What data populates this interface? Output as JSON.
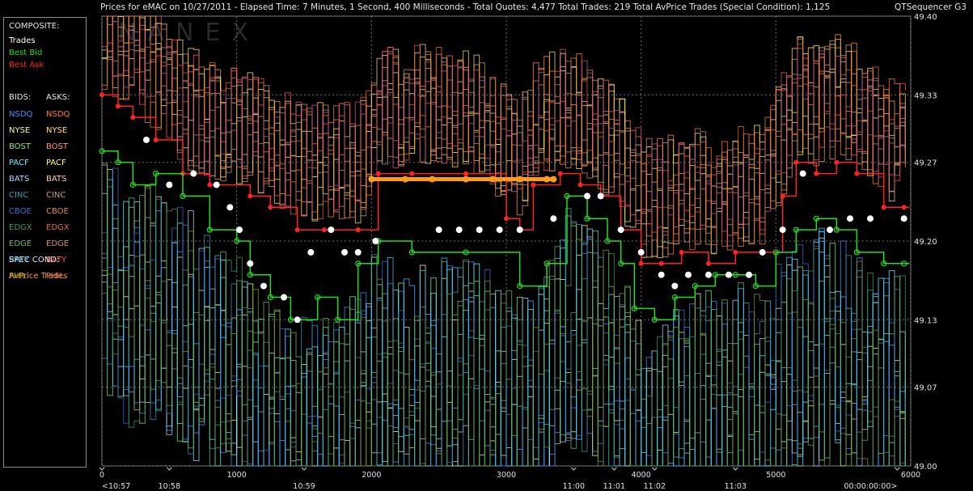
{
  "header": {
    "title": "Prices for  eMAC  on  10/27/2011  -  Elapsed Time: 7 Minutes, 1 Second, 400 Milliseconds  -  Total Quotes: 4,477  Total Trades: 219  Total AvPrice Trades (Special Condition): 1,125",
    "app_name": "QTSequencer G3"
  },
  "watermark": "NANEX",
  "legend": {
    "composite_heading": "COMPOSITE:",
    "composite_items": [
      {
        "label": "Trades",
        "color": "#ffffff"
      },
      {
        "label": "Best Bid",
        "color": "#22dd22"
      },
      {
        "label": "Best Ask",
        "color": "#ff2222"
      }
    ],
    "bids_heading": "BIDS:",
    "asks_heading": "ASKS:",
    "exchanges": [
      {
        "bid": "NSDQ",
        "bid_color": "#4a8cff",
        "ask": "NSDQ",
        "ask_color": "#ff7a2a"
      },
      {
        "bid": "NYSE",
        "bid_color": "#e8ff9a",
        "ask": "NYSE",
        "ask_color": "#ffe15a"
      },
      {
        "bid": "BOST",
        "bid_color": "#8ee88e",
        "ask": "BOST",
        "ask_color": "#ff9a6a"
      },
      {
        "bid": "PACF",
        "bid_color": "#6af0ff",
        "ask": "PACF",
        "ask_color": "#ffff60"
      },
      {
        "bid": "BATS",
        "bid_color": "#a8d8ff",
        "ask": "BATS",
        "ask_color": "#ffd0a0"
      },
      {
        "bid": "CINC",
        "bid_color": "#3a9ab0",
        "ask": "CINC",
        "ask_color": "#c9a060"
      },
      {
        "bid": "CBOE",
        "bid_color": "#3a6ad0",
        "ask": "CBOE",
        "ask_color": "#e09040"
      },
      {
        "bid": "EDGX",
        "bid_color": "#3f9a5a",
        "ask": "EDGX",
        "ask_color": "#e06a3a"
      },
      {
        "bid": "EDGE",
        "bid_color": "#6ab86a",
        "ask": "EDGE",
        "ask_color": "#d08a70"
      },
      {
        "bid": "BATY",
        "bid_color": "#4ac0ff",
        "ask": "BATY",
        "ask_color": "#ff5a5a"
      },
      {
        "bid": "PHIL",
        "bid_color": "#7a9a3a",
        "ask": "PHIL",
        "ask_color": "#c05a8a"
      }
    ],
    "spec_heading": "SPEC COND:",
    "spec_item": {
      "label": "AvPrice Trades",
      "color": "#ff9a1a"
    }
  },
  "chart_data": {
    "type": "line",
    "title": "",
    "ylim": [
      49.0,
      49.4
    ],
    "xlim": [
      0,
      6000
    ],
    "y_ticks": [
      "49.40",
      "49.33",
      "49.27",
      "49.20",
      "49.13",
      "49.07",
      "49.00"
    ],
    "x_ticks": [
      "0",
      "1000",
      "2000",
      "3000",
      "4000",
      "5000",
      "6000"
    ],
    "time_labels": [
      {
        "x": 0,
        "label": "<10:57"
      },
      {
        "x": 500,
        "label": "10:58"
      },
      {
        "x": 1500,
        "label": "10:59"
      },
      {
        "x": 3500,
        "label": "11:00"
      },
      {
        "x": 3800,
        "label": "11:01"
      },
      {
        "x": 4100,
        "label": "11:02"
      },
      {
        "x": 4700,
        "label": "11:03"
      },
      {
        "x": 5900,
        "label": "00:00:00:00>"
      }
    ],
    "grid": true,
    "series": [
      {
        "name": "Best Ask",
        "color": "#ff2222",
        "values": [
          [
            0,
            49.33
          ],
          [
            120,
            49.32
          ],
          [
            230,
            49.31
          ],
          [
            400,
            49.29
          ],
          [
            600,
            49.26
          ],
          [
            800,
            49.25
          ],
          [
            1100,
            49.24
          ],
          [
            1250,
            49.23
          ],
          [
            1450,
            49.21
          ],
          [
            1650,
            49.21
          ],
          [
            1900,
            49.21
          ],
          [
            2050,
            49.26
          ],
          [
            2300,
            49.26
          ],
          [
            2700,
            49.26
          ],
          [
            3000,
            49.22
          ],
          [
            3100,
            49.21
          ],
          [
            3200,
            49.25
          ],
          [
            3400,
            49.26
          ],
          [
            3550,
            49.25
          ],
          [
            3700,
            49.24
          ],
          [
            3850,
            49.21
          ],
          [
            4000,
            49.18
          ],
          [
            4150,
            49.18
          ],
          [
            4300,
            49.19
          ],
          [
            4500,
            49.18
          ],
          [
            4700,
            49.19
          ],
          [
            4900,
            49.19
          ],
          [
            5050,
            49.24
          ],
          [
            5150,
            49.27
          ],
          [
            5300,
            49.26
          ],
          [
            5450,
            49.27
          ],
          [
            5600,
            49.26
          ],
          [
            5800,
            49.23
          ],
          [
            5950,
            49.23
          ]
        ]
      },
      {
        "name": "Best Bid",
        "color": "#22dd22",
        "values": [
          [
            0,
            49.28
          ],
          [
            120,
            49.27
          ],
          [
            230,
            49.25
          ],
          [
            400,
            49.26
          ],
          [
            600,
            49.24
          ],
          [
            800,
            49.21
          ],
          [
            1000,
            49.2
          ],
          [
            1100,
            49.17
          ],
          [
            1250,
            49.15
          ],
          [
            1400,
            49.13
          ],
          [
            1600,
            49.15
          ],
          [
            1750,
            49.13
          ],
          [
            1900,
            49.18
          ],
          [
            2050,
            49.2
          ],
          [
            2300,
            49.19
          ],
          [
            2700,
            49.19
          ],
          [
            3100,
            49.16
          ],
          [
            3300,
            49.18
          ],
          [
            3450,
            49.24
          ],
          [
            3600,
            49.22
          ],
          [
            3750,
            49.2
          ],
          [
            3850,
            49.18
          ],
          [
            3950,
            49.14
          ],
          [
            4100,
            49.13
          ],
          [
            4250,
            49.15
          ],
          [
            4400,
            49.16
          ],
          [
            4550,
            49.17
          ],
          [
            4700,
            49.17
          ],
          [
            4850,
            49.16
          ],
          [
            5000,
            49.19
          ],
          [
            5150,
            49.21
          ],
          [
            5300,
            49.22
          ],
          [
            5450,
            49.21
          ],
          [
            5600,
            49.19
          ],
          [
            5800,
            49.18
          ],
          [
            5950,
            49.18
          ]
        ]
      },
      {
        "name": "Trades",
        "color": "#ffffff",
        "values": [
          [
            330,
            49.29
          ],
          [
            500,
            49.25
          ],
          [
            680,
            49.26
          ],
          [
            850,
            49.25
          ],
          [
            950,
            49.23
          ],
          [
            1020,
            49.21
          ],
          [
            1100,
            49.18
          ],
          [
            1200,
            49.16
          ],
          [
            1350,
            49.15
          ],
          [
            1450,
            49.13
          ],
          [
            1550,
            49.19
          ],
          [
            1700,
            49.21
          ],
          [
            1800,
            49.19
          ],
          [
            1900,
            49.19
          ],
          [
            2030,
            49.2
          ],
          [
            2500,
            49.21
          ],
          [
            2650,
            49.21
          ],
          [
            2800,
            49.21
          ],
          [
            2950,
            49.21
          ],
          [
            3100,
            49.21
          ],
          [
            3350,
            49.22
          ],
          [
            3600,
            49.24
          ],
          [
            3700,
            49.24
          ],
          [
            3850,
            49.21
          ],
          [
            4000,
            49.19
          ],
          [
            4150,
            49.17
          ],
          [
            4250,
            49.16
          ],
          [
            4350,
            49.17
          ],
          [
            4500,
            49.17
          ],
          [
            4650,
            49.17
          ],
          [
            4800,
            49.17
          ],
          [
            4900,
            49.19
          ],
          [
            5050,
            49.21
          ],
          [
            5200,
            49.26
          ],
          [
            5400,
            49.21
          ],
          [
            5550,
            49.22
          ],
          [
            5700,
            49.22
          ],
          [
            5950,
            49.22
          ]
        ]
      },
      {
        "name": "AvPrice Trades",
        "color": "#ff9a1a",
        "values": [
          [
            2000,
            49.255
          ],
          [
            2250,
            49.255
          ],
          [
            2450,
            49.255
          ],
          [
            2700,
            49.255
          ],
          [
            2900,
            49.255
          ],
          [
            3100,
            49.255
          ],
          [
            3300,
            49.255
          ],
          [
            3350,
            49.255
          ]
        ]
      }
    ]
  }
}
